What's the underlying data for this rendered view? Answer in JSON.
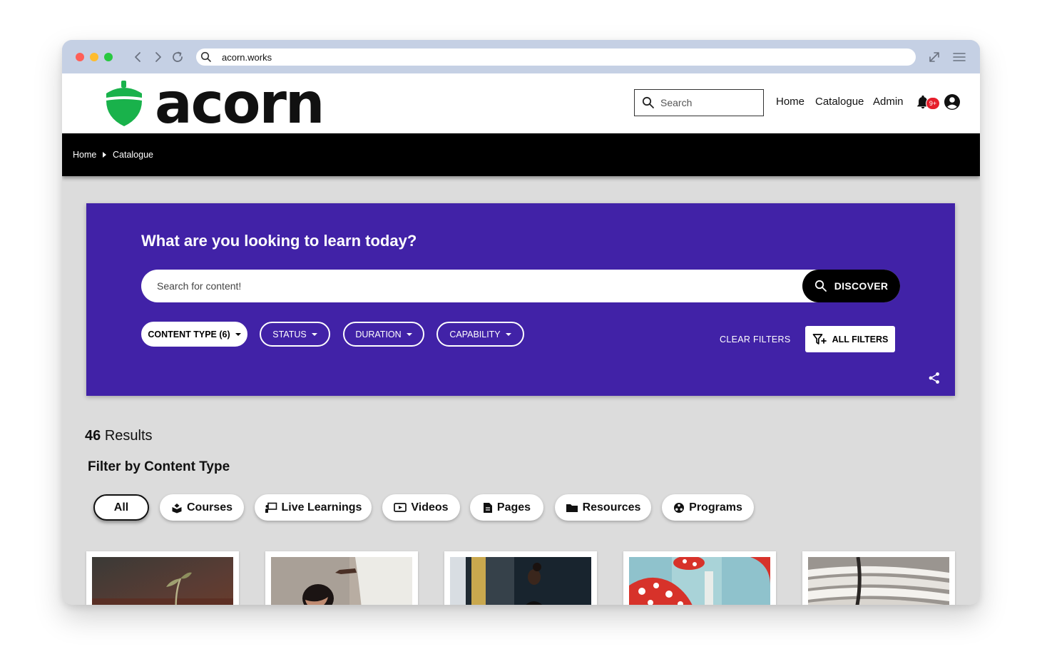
{
  "browser": {
    "url": "acorn.works",
    "colors": {
      "chrome": "#c5d0e4",
      "close": "#ff5f57",
      "minimize": "#febc2e",
      "zoom": "#28c840"
    },
    "icons": [
      "back-icon",
      "forward-icon",
      "reload-icon",
      "search-icon",
      "expand-icon",
      "menu-icon"
    ]
  },
  "header": {
    "logo_text": "acorn",
    "logo_color": "#19b24b",
    "search_placeholder": "Search",
    "nav": [
      "Home",
      "Catalogue",
      "Admin"
    ],
    "notification_badge": "9+",
    "icons": [
      "bell-icon",
      "user-avatar-icon"
    ]
  },
  "breadcrumb": [
    "Home",
    "Catalogue"
  ],
  "hero": {
    "background": "#4122a7",
    "title": "What are you looking to learn today?",
    "search_placeholder": "Search for content!",
    "discover_label": "DISCOVER",
    "filters": [
      {
        "label": "CONTENT TYPE (6)",
        "active": true
      },
      {
        "label": "STATUS",
        "active": false
      },
      {
        "label": "DURATION",
        "active": false
      },
      {
        "label": "CAPABILITY",
        "active": false
      }
    ],
    "clear_filters_label": "CLEAR FILTERS",
    "all_filters_label": "ALL FILTERS"
  },
  "results": {
    "count": "46",
    "label": "Results"
  },
  "content_type_filter": {
    "heading": "Filter by Content Type",
    "types": [
      {
        "label": "All",
        "icon": "",
        "selected": true
      },
      {
        "label": "Courses",
        "icon": "courses-icon",
        "selected": false
      },
      {
        "label": "Live Learnings",
        "icon": "live-learning-icon",
        "selected": false
      },
      {
        "label": "Videos",
        "icon": "video-icon",
        "selected": false
      },
      {
        "label": "Pages",
        "icon": "page-icon",
        "selected": false
      },
      {
        "label": "Resources",
        "icon": "folder-icon",
        "selected": false
      },
      {
        "label": "Programs",
        "icon": "programs-icon",
        "selected": false
      }
    ]
  },
  "cards": [
    {
      "image": "seedling-sprout-photo"
    },
    {
      "image": "person-writing-with-helper-photo"
    },
    {
      "image": "person-at-computer-photo"
    },
    {
      "image": "red-mushrooms-photo"
    },
    {
      "image": "stacked-papers-photo"
    }
  ]
}
